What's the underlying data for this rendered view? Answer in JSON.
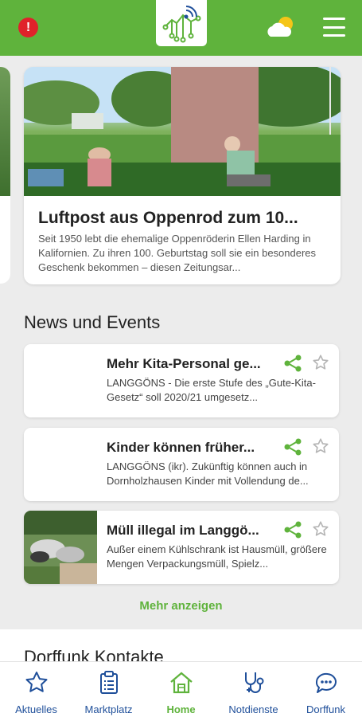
{
  "colors": {
    "brand_green": "#5fb33c",
    "nav_blue": "#1f4f9a",
    "alert_red": "#e0222a"
  },
  "header": {
    "alert_icon": "!",
    "logo": "village-network-logo",
    "weather": "sun-cloud-icon",
    "menu": "hamburger-menu-icon"
  },
  "hero": {
    "title": "Luftpost aus Oppenrod zum 10...",
    "text": "Seit 1950 lebt die ehemalige Oppenröderin Ellen Harding in Kalifornien. Zu ihren 100. Geburtstag soll sie ein besonderes Geschenk bekommen – diesen Zeitungsar..."
  },
  "news": {
    "section_title": "News und Events",
    "items": [
      {
        "title": "Mehr Kita-Personal ge...",
        "text": "LANGGÖNS - Die erste Stufe des „Gute-Kita-Gesetz“ soll 2020/21 umgesetz..."
      },
      {
        "title": "Kinder können früher...",
        "text": "LANGGÖNS (ikr). Zukünftig können auch in Dornholzhausen Kinder mit Vollendung de..."
      },
      {
        "title": "Müll illegal im Langgö...",
        "text": "Außer einem Kühlschrank ist Hausmüll, größere Mengen Verpackungsmüll, Spielz..."
      }
    ],
    "more_label": "Mehr anzeigen"
  },
  "contacts": {
    "section_title": "Dorffunk Kontakte"
  },
  "bottom_nav": {
    "items": [
      {
        "label": "Aktuelles",
        "icon": "star-icon"
      },
      {
        "label": "Marktplatz",
        "icon": "clipboard-icon"
      },
      {
        "label": "Home",
        "icon": "home-icon"
      },
      {
        "label": "Notdienste",
        "icon": "stethoscope-icon"
      },
      {
        "label": "Dorffunk",
        "icon": "chat-bubble-icon"
      }
    ],
    "active": "Home"
  }
}
